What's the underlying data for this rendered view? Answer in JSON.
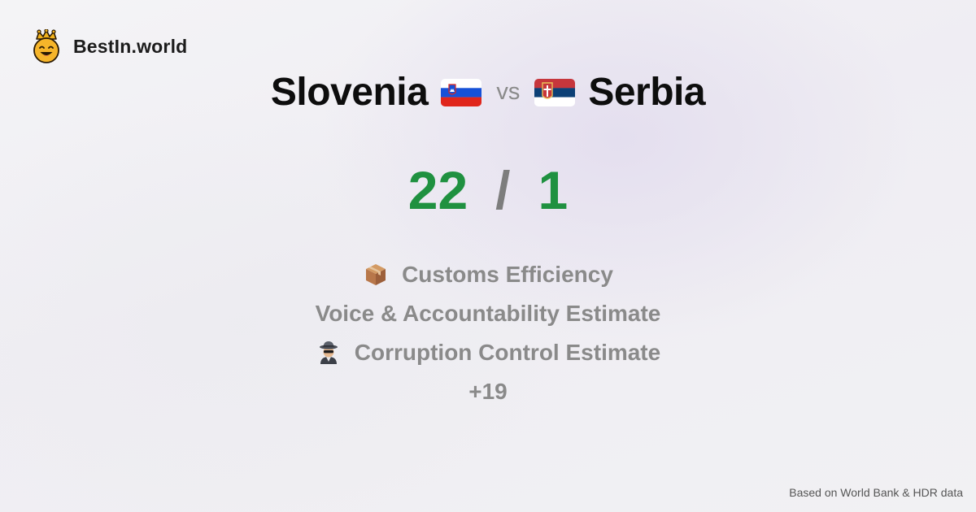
{
  "brand": {
    "name": "BestIn.world",
    "icon": "crowned-smiley-icon"
  },
  "comparison": {
    "left": {
      "name": "Slovenia",
      "flag_icon": "slovenia-flag-icon",
      "flag_colors": [
        "#ffffff",
        "#1651d8",
        "#e0251b"
      ]
    },
    "vs_label": "vs",
    "right": {
      "name": "Serbia",
      "flag_icon": "serbia-flag-icon",
      "flag_colors": [
        "#c6363c",
        "#0c4076",
        "#ffffff"
      ]
    }
  },
  "score": {
    "left": "22",
    "separator": "/",
    "right": "1",
    "color": "#1f9140"
  },
  "metrics": [
    {
      "label": "Customs Efficiency",
      "icon": "package-icon"
    },
    {
      "label": "Voice & Accountability Estimate",
      "icon": ""
    },
    {
      "label": "Corruption Control Estimate",
      "icon": "detective-icon"
    }
  ],
  "more_label": "+19",
  "footer": {
    "source": "Based on World Bank & HDR data"
  }
}
